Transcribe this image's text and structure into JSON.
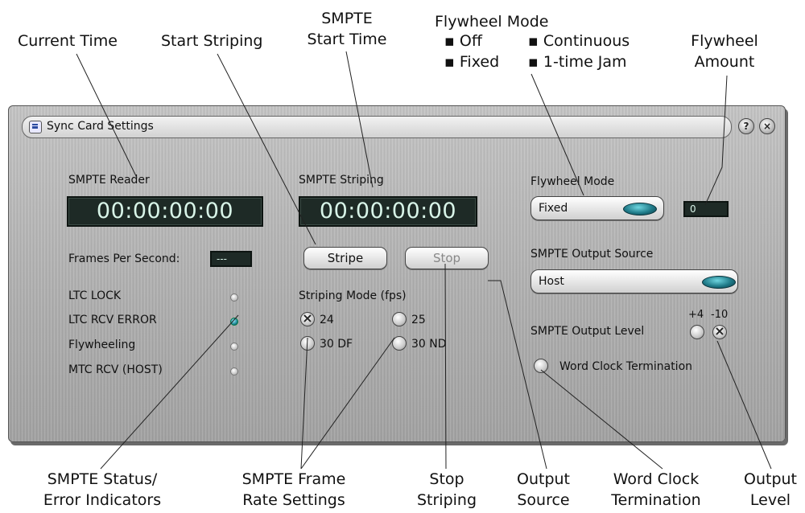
{
  "callouts": {
    "current_time": "Current Time",
    "start_striping": "Start Striping",
    "smpte_start_time_1": "SMPTE",
    "smpte_start_time_2": "Start Time",
    "flywheel_mode_title": "Flywheel Mode",
    "flywheel_mode_opts": [
      "Off",
      "Fixed",
      "Continuous",
      "1-time Jam"
    ],
    "flywheel_amount_1": "Flywheel",
    "flywheel_amount_2": "Amount",
    "status_1": "SMPTE Status/",
    "status_2": "Error Indicators",
    "frame_rate_1": "SMPTE Frame",
    "frame_rate_2": "Rate Settings",
    "stop_1": "Stop",
    "stop_2": "Striping",
    "output_source_1": "Output",
    "output_source_2": "Source",
    "word_clock_1": "Word Clock",
    "word_clock_2": "Termination",
    "output_level_1": "Output",
    "output_level_2": "Level"
  },
  "window": {
    "title": "Sync Card Settings",
    "help_label": "?",
    "close_label": "×"
  },
  "reader": {
    "label": "SMPTE Reader",
    "time": "00:00:00:00",
    "fps_label": "Frames Per Second:",
    "fps_value": "---"
  },
  "indicators": [
    {
      "label": "LTC LOCK",
      "state": "off"
    },
    {
      "label": "LTC RCV ERROR",
      "state": "on"
    },
    {
      "label": "Flywheeling",
      "state": "off"
    },
    {
      "label": "MTC RCV (HOST)",
      "state": "off"
    }
  ],
  "striping": {
    "label": "SMPTE Striping",
    "time": "00:00:00:00",
    "stripe_label": "Stripe",
    "stop_label": "Stop",
    "mode_label": "Striping Mode (fps)",
    "modes": [
      {
        "label": "24",
        "selected": true
      },
      {
        "label": "25",
        "selected": false
      },
      {
        "label": "30 DF",
        "selected": false
      },
      {
        "label": "30 ND",
        "selected": false
      }
    ]
  },
  "flywheel": {
    "label": "Flywheel Mode",
    "value": "Fixed",
    "amount": "0"
  },
  "output": {
    "source_label": "SMPTE Output Source",
    "source_value": "Host",
    "level_label": "SMPTE Output Level",
    "level_plus": "+4",
    "level_minus": "-10",
    "level_selected": "-10",
    "word_clock_label": "Word Clock Termination"
  },
  "colors": {
    "panel": "#b4b4b4",
    "lcd_bg": "#1e2a26",
    "lcd_text": "#d8f4e8",
    "accent_knob": "#1f7a88"
  }
}
